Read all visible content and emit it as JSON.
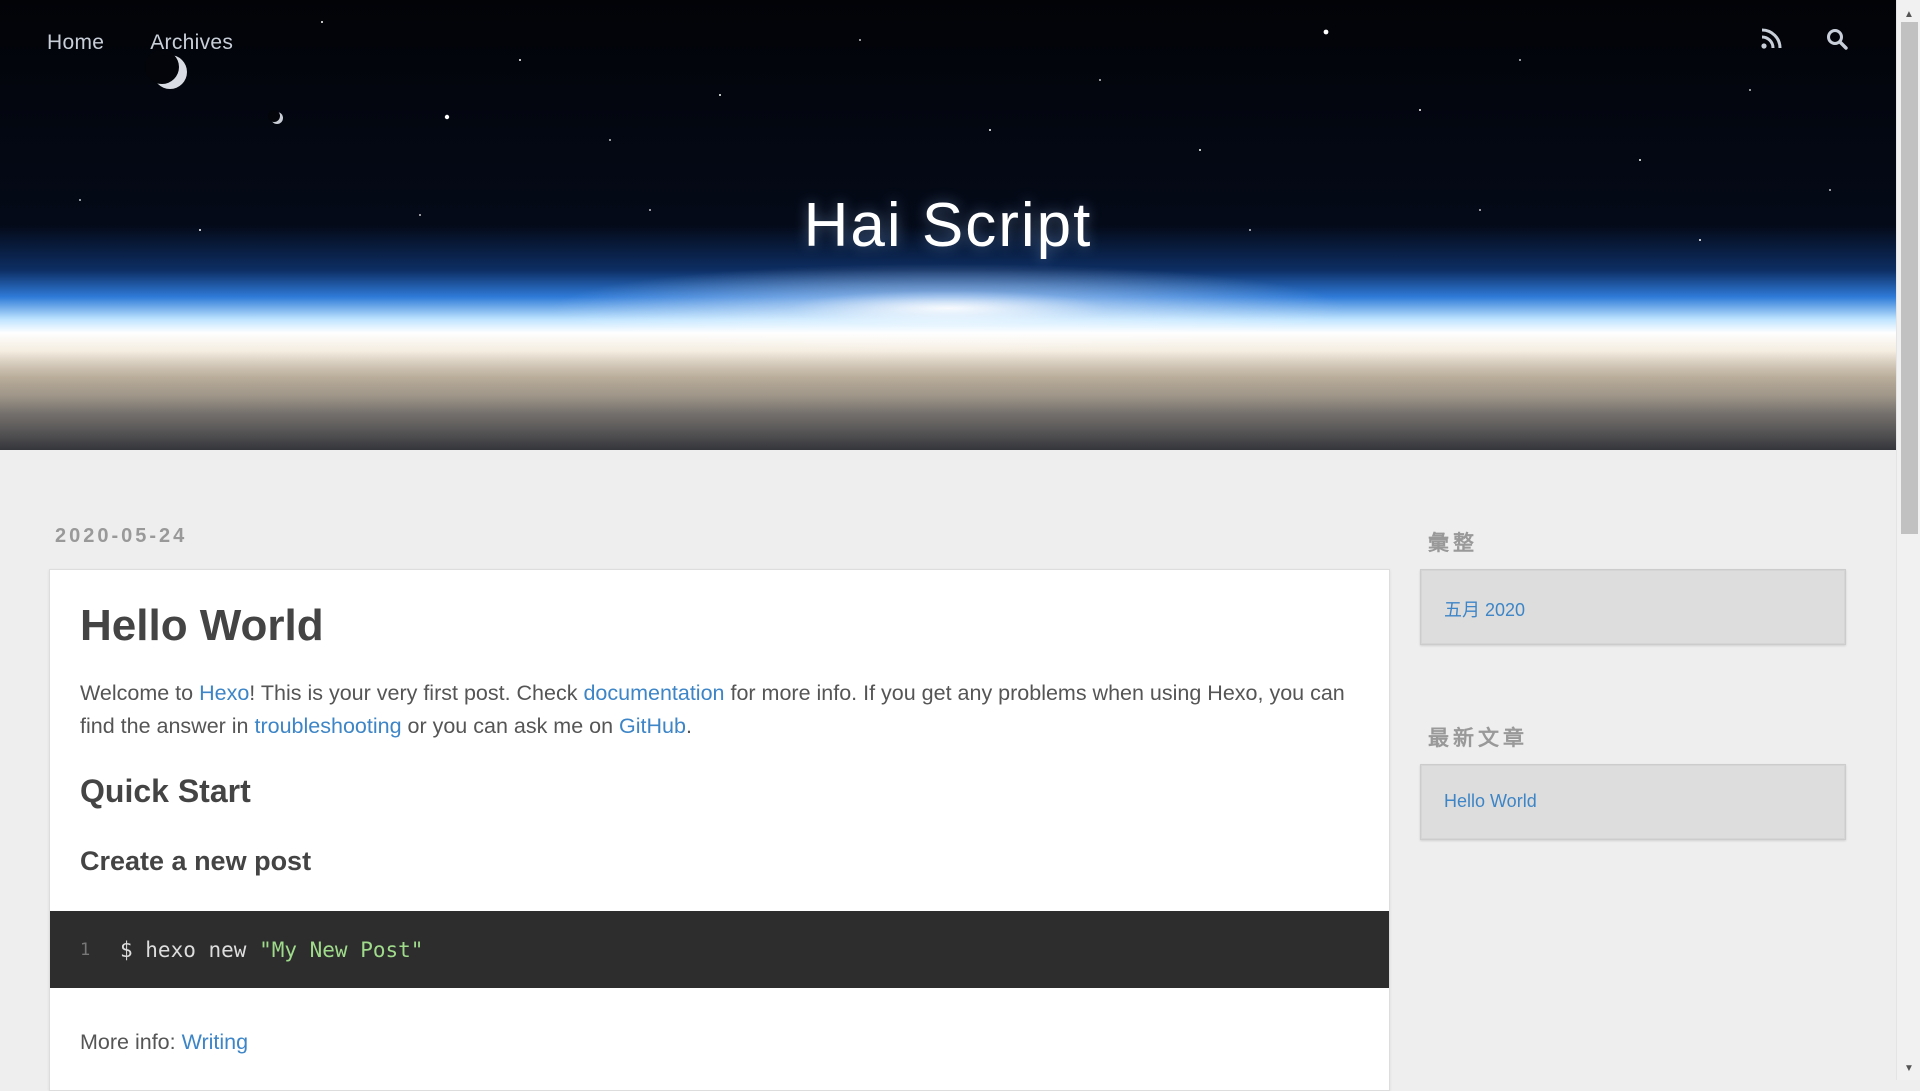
{
  "nav": {
    "home": "Home",
    "archives": "Archives",
    "rss_icon": "rss-icon",
    "search_icon": "search-icon"
  },
  "site": {
    "title": "Hai Script"
  },
  "post": {
    "date": "2020-05-24",
    "title": "Hello World",
    "intro": {
      "t1": "Welcome to ",
      "link_hexo": "Hexo",
      "t2": "! This is your very first post. Check ",
      "link_docs": "documentation",
      "t3": " for more info. If you get any problems when using Hexo, you can find the answer in ",
      "link_troubleshooting": "troubleshooting",
      "t4": " or you can ask me on ",
      "link_github": "GitHub",
      "t5": "."
    },
    "h2_quick_start": "Quick Start",
    "h3_create_post": "Create a new post",
    "code": {
      "line_no": "1",
      "command": "$ hexo new ",
      "string": "\"My New Post\""
    },
    "more_info_label": "More info: ",
    "more_info_link": "Writing"
  },
  "sidebar": {
    "archive_title": "彙整",
    "archive_item": "五月 2020",
    "recent_title": "最新文章",
    "recent_item": "Hello World"
  },
  "colors": {
    "link": "#3d85c6",
    "page_bg": "#eeeeee",
    "code_bg": "#2d2d2d",
    "code_string": "#9fdb8b"
  }
}
